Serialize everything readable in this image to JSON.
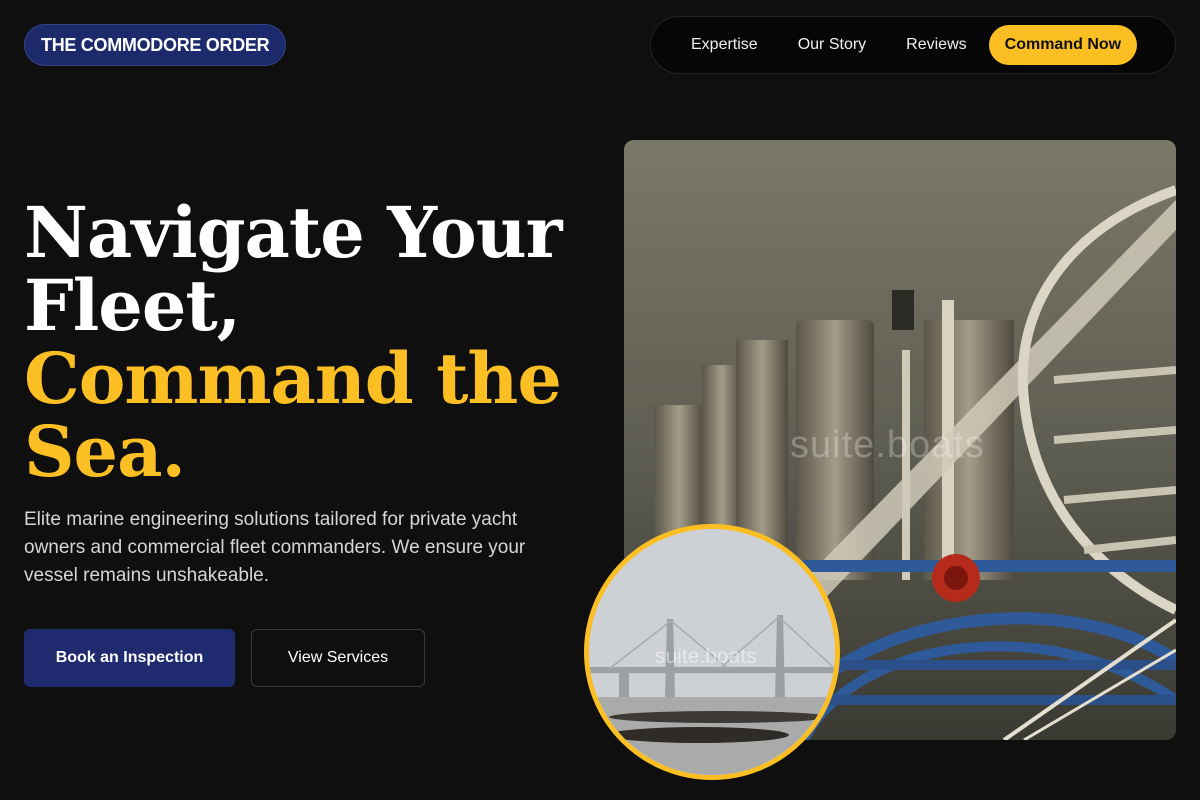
{
  "brand": {
    "logo_text": "THE COMMODORE ORDER"
  },
  "nav": {
    "items": [
      {
        "label": "Expertise"
      },
      {
        "label": "Our Story"
      },
      {
        "label": "Reviews"
      }
    ],
    "cta_label": "Command Now"
  },
  "hero": {
    "title_line1": "Navigate Your",
    "title_line2": "Fleet,",
    "title_line3": "Command the",
    "title_line4": "Sea.",
    "subtitle": "Elite marine engineering solutions tailored for private yacht owners and commercial fleet commanders. We ensure your vessel remains unshakeable.",
    "primary_button": "Book an Inspection",
    "secondary_button": "View Services"
  },
  "images": {
    "main_watermark": "suite.boats",
    "circle_watermark": "suite.boats"
  },
  "colors": {
    "accent": "#fbbf24",
    "brand_blue": "#1f2a6f",
    "background": "#0f0f10"
  }
}
